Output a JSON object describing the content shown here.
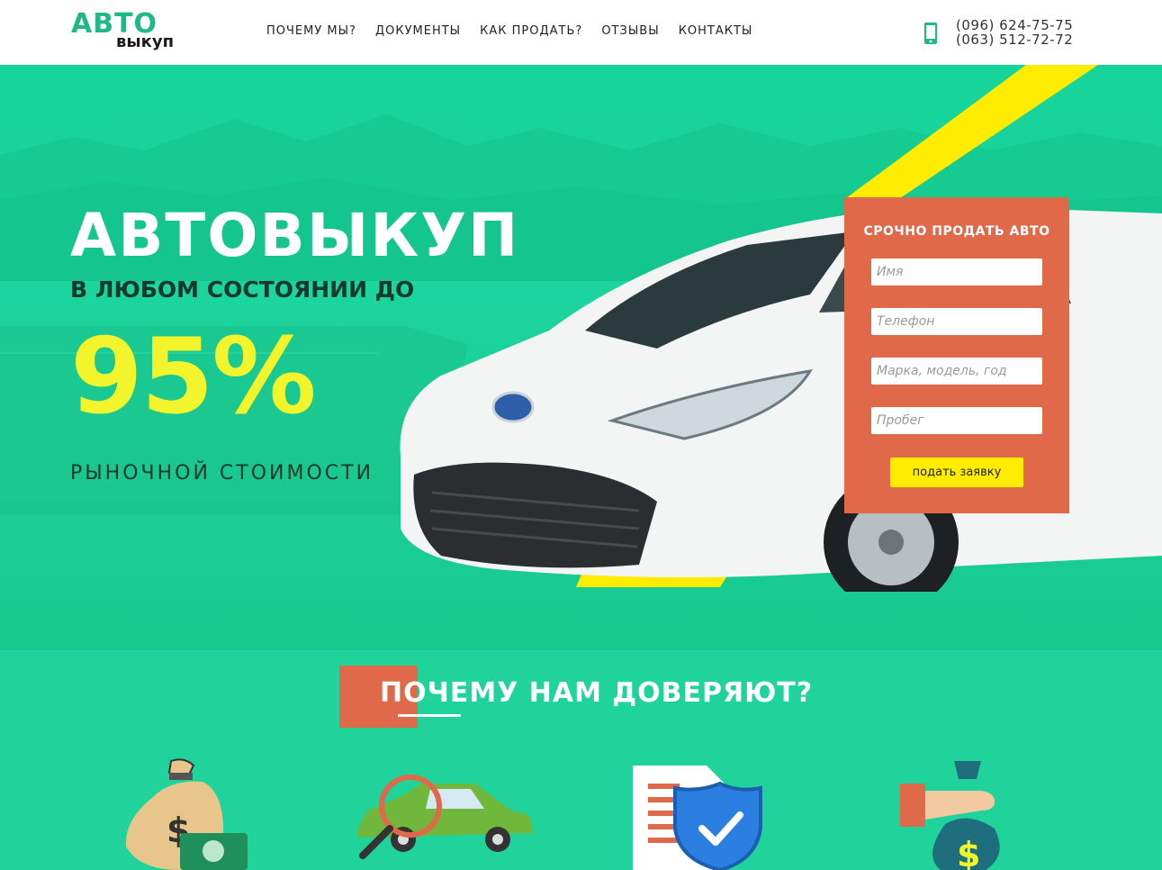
{
  "header": {
    "logo_top": "АВТО",
    "logo_bottom": "выкуп",
    "nav": [
      "ПОЧЕМУ МЫ?",
      "ДОКУМЕНТЫ",
      "КАК ПРОДАТЬ?",
      "ОТЗЫВЫ",
      "КОНТАКТЫ"
    ],
    "phone_1": "(096) 624-75-75",
    "phone_2": "(063) 512-72-72",
    "phone_icon": "mobile-phone-icon"
  },
  "hero": {
    "title": "АВТОВЫКУП",
    "subtitle": "В ЛЮБОМ СОСТОЯНИИ ДО",
    "percent": "95%",
    "market": "РЫНОЧНОЙ СТОИМОСТИ"
  },
  "form": {
    "title": "СРОЧНО ПРОДАТЬ АВТО",
    "name_placeholder": "Имя",
    "phone_placeholder": "Телефон",
    "car_placeholder": "Марка, модель, год",
    "mileage_placeholder": "Пробег",
    "submit_label": "подать заявку"
  },
  "why": {
    "title": "ПОЧЕМУ НАМ ДОВЕРЯЮТ?",
    "features": [
      {
        "icon": "money-bag-icon"
      },
      {
        "icon": "car-inspection-icon"
      },
      {
        "icon": "document-shield-icon"
      },
      {
        "icon": "hand-money-bag-icon"
      }
    ]
  },
  "colors": {
    "brand_green": "#1fd39a",
    "accent_orange": "#e0694a",
    "accent_yellow": "#ffec00",
    "percent_yellow": "#f2f52b"
  }
}
